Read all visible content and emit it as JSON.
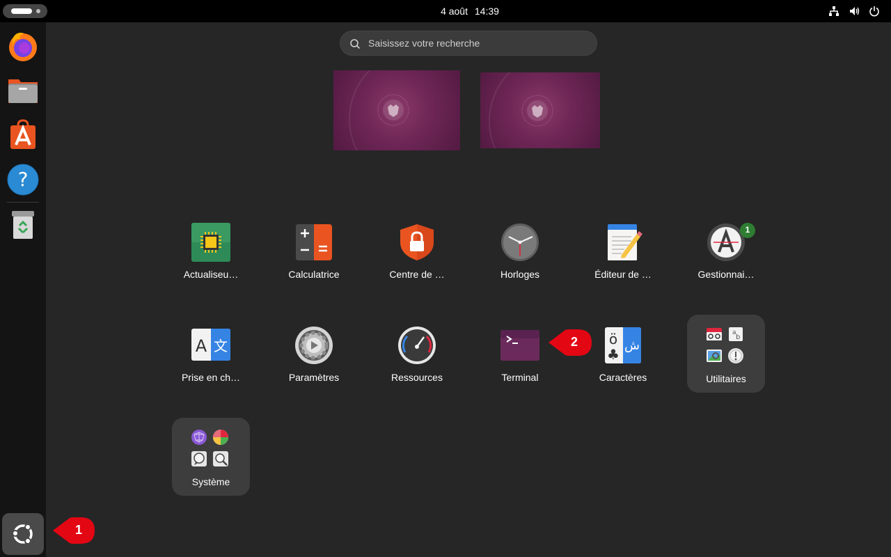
{
  "topbar": {
    "date": "4 août",
    "time": "14:39",
    "tray_icons": [
      "network-icon",
      "volume-icon",
      "power-icon"
    ]
  },
  "dock": {
    "items": [
      "firefox-icon",
      "files-icon",
      "app-center-icon",
      "help-icon",
      "trash-icon"
    ],
    "show_apps": "show-apps-icon"
  },
  "search": {
    "placeholder": "Saisissez votre recherche",
    "value": ""
  },
  "workspaces": {
    "count": 2
  },
  "apps": [
    {
      "label": "Actualiseu…",
      "icon": "firmware-updater-icon"
    },
    {
      "label": "Calculatrice",
      "icon": "calculator-icon"
    },
    {
      "label": "Centre de …",
      "icon": "security-center-icon"
    },
    {
      "label": "Horloges",
      "icon": "clocks-icon"
    },
    {
      "label": "Éditeur de …",
      "icon": "text-editor-icon"
    },
    {
      "label": "Gestionnai…",
      "icon": "software-manager-icon",
      "badge": "1"
    },
    {
      "label": "Prise en ch…",
      "icon": "language-support-icon"
    },
    {
      "label": "Paramètres",
      "icon": "settings-icon"
    },
    {
      "label": "Ressources",
      "icon": "resources-icon"
    },
    {
      "label": "Terminal",
      "icon": "terminal-icon"
    },
    {
      "label": "Caractères",
      "icon": "characters-icon"
    }
  ],
  "folders": [
    {
      "label": "Utilitaires"
    },
    {
      "label": "Système"
    }
  ],
  "callouts": [
    "1",
    "2"
  ],
  "colors": {
    "background": "#262626",
    "topbar": "#000000",
    "dock": "#141414",
    "callout": "#e30613",
    "wallpaper": "#6e2656",
    "badge": "#2e7d32"
  }
}
